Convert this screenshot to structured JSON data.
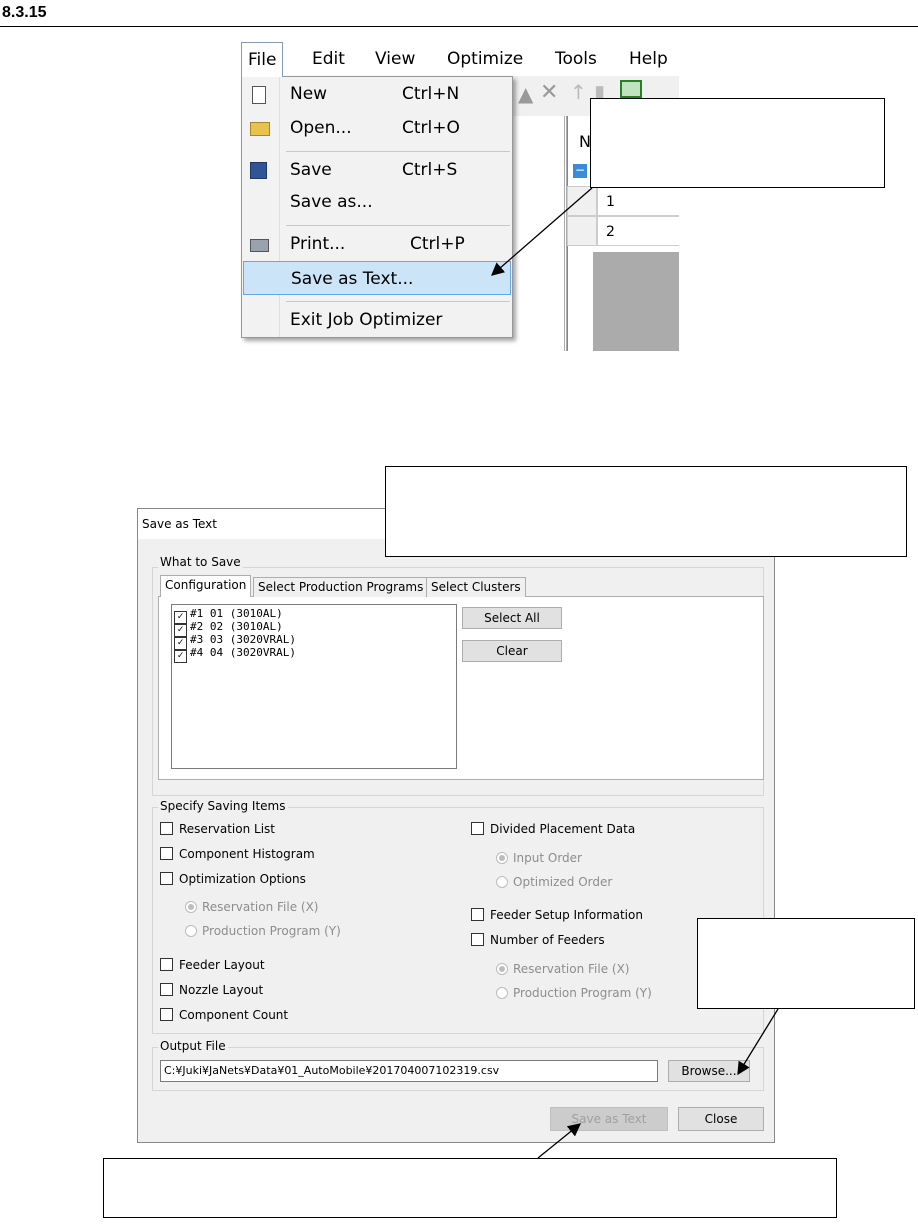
{
  "section_number": "8.3.15",
  "menu_screenshot": {
    "menubar": [
      "File",
      "Edit",
      "View",
      "Optimize",
      "Tools",
      "Help"
    ],
    "file_menu": [
      {
        "label": "New",
        "shortcut": "Ctrl+N",
        "icon": "new-document-icon"
      },
      {
        "label": "Open...",
        "shortcut": "Ctrl+O",
        "icon": "open-folder-icon"
      },
      {
        "label": "Save",
        "shortcut": "Ctrl+S",
        "icon": "floppy-disk-icon"
      },
      {
        "label": "Save as...",
        "shortcut": "",
        "icon": ""
      },
      {
        "label": "Print...",
        "shortcut": "Ctrl+P",
        "icon": "printer-icon"
      },
      {
        "label": "Save as Text...",
        "shortcut": "",
        "icon": "",
        "highlighted": true
      },
      {
        "label": "Exit Job Optimizer",
        "shortcut": "",
        "icon": ""
      }
    ],
    "grid": {
      "header_partial": "N",
      "rows": [
        "1",
        "2"
      ]
    }
  },
  "dialog": {
    "title": "Save as Text",
    "what_to_save": {
      "label": "What to Save",
      "tabs": [
        {
          "label": "Configuration",
          "active": true
        },
        {
          "label": "Select Production Programs",
          "active": false
        },
        {
          "label": "Select Clusters",
          "active": false
        }
      ],
      "items": [
        {
          "label": "#1 01 (3010AL)",
          "checked": true
        },
        {
          "label": "#2 02 (3010AL)",
          "checked": true
        },
        {
          "label": "#3 03 (3020VRAL)",
          "checked": true
        },
        {
          "label": "#4 04 (3020VRAL)",
          "checked": true
        }
      ],
      "select_all": "Select All",
      "clear": "Clear"
    },
    "saving_items": {
      "label": "Specify Saving Items",
      "reservation_list": "Reservation List",
      "component_histogram": "Component Histogram",
      "optimization_options": "Optimization Options",
      "opt_reservation_file": "Reservation File (X)",
      "opt_production_program": "Production Program (Y)",
      "feeder_layout": "Feeder Layout",
      "nozzle_layout": "Nozzle Layout",
      "component_count": "Component Count",
      "divided_placement": "Divided Placement Data",
      "input_order": "Input Order",
      "optimized_order": "Optimized Order",
      "feeder_setup": "Feeder Setup Information",
      "number_of_feeders": "Number of Feeders",
      "nf_reservation_file": "Reservation File (X)",
      "nf_production_program": "Production Program (Y)"
    },
    "output_file": {
      "label": "Output File",
      "path": "C:¥Juki¥JaNets¥Data¥01_AutoMobile¥201704007102319.csv",
      "browse": "Browse..."
    },
    "save_as_text_button": "Save as Text",
    "close_button": "Close"
  }
}
